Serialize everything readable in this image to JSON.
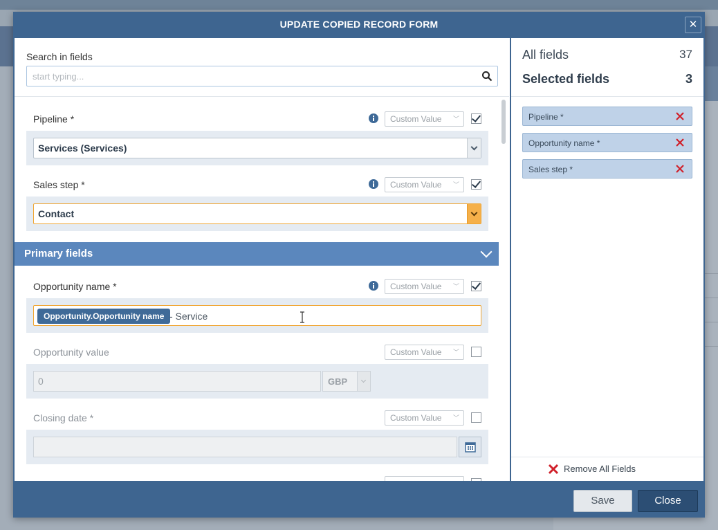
{
  "modal": {
    "title": "UPDATE COPIED RECORD FORM",
    "close_glyph": "✕",
    "save_label": "Save",
    "close_label": "Close"
  },
  "search": {
    "label": "Search in fields",
    "placeholder": "start typing..."
  },
  "fields": {
    "pipeline": {
      "label": "Pipeline *",
      "mode": "Custom Value",
      "checked": true,
      "value": "Services (Services)"
    },
    "sales_step": {
      "label": "Sales step *",
      "mode": "Custom Value",
      "checked": true,
      "value": "Contact"
    },
    "opportunity_name": {
      "label": "Opportunity name *",
      "mode": "Custom Value",
      "checked": true,
      "token": "Opportunity.Opportunity name",
      "suffix": "- Service"
    },
    "opportunity_value": {
      "label": "Opportunity value",
      "mode": "Custom Value",
      "checked": false,
      "value": "0",
      "currency": "GBP"
    },
    "closing_date": {
      "label": "Closing date *",
      "mode": "Custom Value",
      "checked": false,
      "value": ""
    }
  },
  "section": {
    "title": "Primary fields"
  },
  "right_panel": {
    "all_fields_label": "All fields",
    "all_fields_count": "37",
    "selected_fields_label": "Selected fields",
    "selected_fields_count": "3",
    "selected": [
      "Pipeline *",
      "Opportunity name *",
      "Sales step *"
    ],
    "remove_all_label": "Remove All Fields"
  },
  "colors": {
    "modal_header": "#3e6590",
    "section_header": "#5b87bd",
    "chip": "#bfd2e8",
    "remove_red": "#d0202a",
    "active_border": "#f0a531"
  }
}
